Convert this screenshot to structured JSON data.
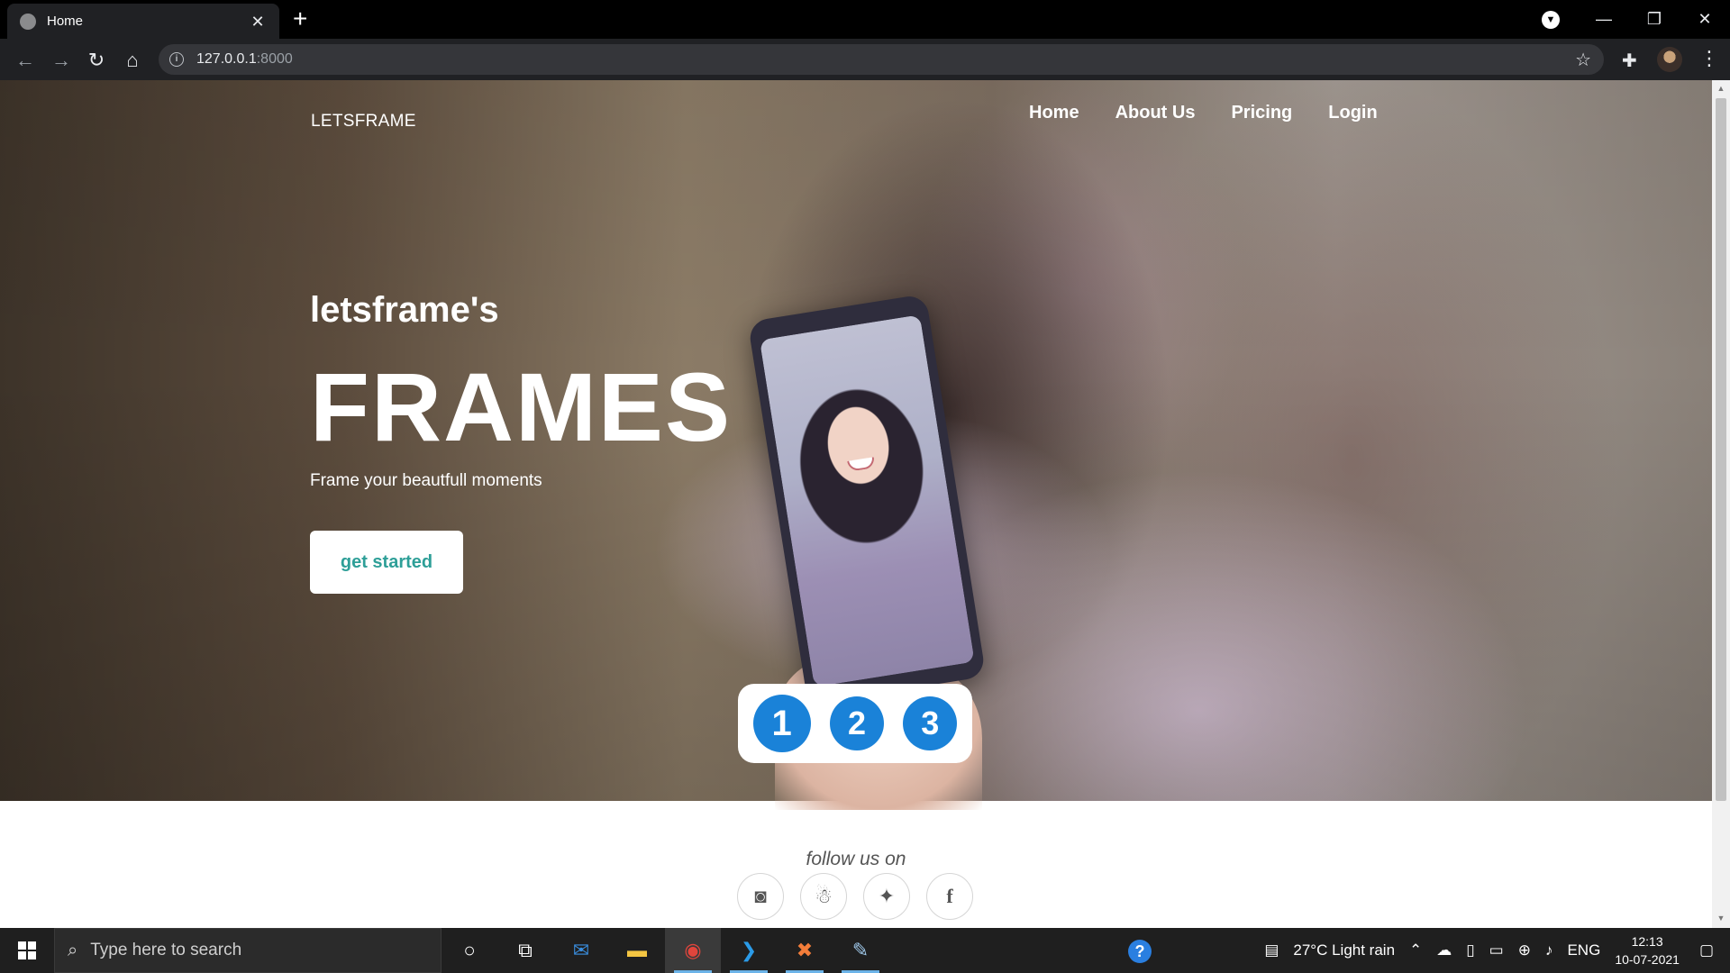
{
  "browser": {
    "tab_title": "Home",
    "url_host": "127.0.0.1",
    "url_port": ":8000"
  },
  "site": {
    "brand": "LETSFRAME",
    "nav": [
      "Home",
      "About Us",
      "Pricing",
      "Login"
    ],
    "hero_sub": "letsframe's",
    "hero_title": "FRAMES",
    "hero_tagline": "Frame your beautfull moments",
    "cta_label": "get started",
    "pager": [
      "1",
      "2",
      "3"
    ],
    "follow_label": "follow us on",
    "socials": [
      "instagram-icon",
      "snapchat-icon",
      "twitter-icon",
      "facebook-icon"
    ],
    "colors": {
      "cta_text": "#2e9f98",
      "pager": "#1a82d8"
    }
  },
  "taskbar": {
    "search_placeholder": "Type here to search",
    "weather": "27°C  Light rain",
    "language": "ENG",
    "time": "12:13",
    "date": "10-07-2021"
  }
}
